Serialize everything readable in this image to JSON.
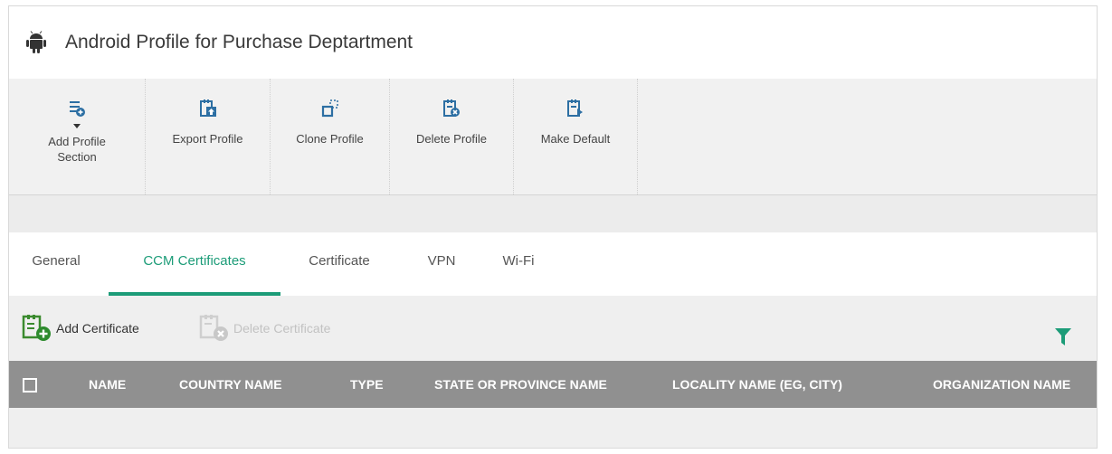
{
  "profile": {
    "title": "Android Profile for Purchase Deptartment",
    "icon": "android-icon"
  },
  "toolbar": {
    "add_section_line1": "Add Profile",
    "add_section_line2": "Section",
    "export": "Export Profile",
    "clone": "Clone Profile",
    "delete": "Delete Profile",
    "make_default": "Make Default"
  },
  "tabs": [
    "General",
    "CCM Certificates",
    "Certificate",
    "VPN",
    "Wi-Fi"
  ],
  "active_tab": "CCM Certificates",
  "actions": {
    "add_certificate": "Add Certificate",
    "delete_certificate": "Delete Certificate"
  },
  "table": {
    "columns": [
      "NAME",
      "COUNTRY NAME",
      "TYPE",
      "STATE OR PROVINCE NAME",
      "LOCALITY NAME (EG, CITY)",
      "ORGANIZATION NAME"
    ],
    "rows": []
  },
  "colors": {
    "accent": "#1c9c78",
    "header_bg": "#909090"
  }
}
